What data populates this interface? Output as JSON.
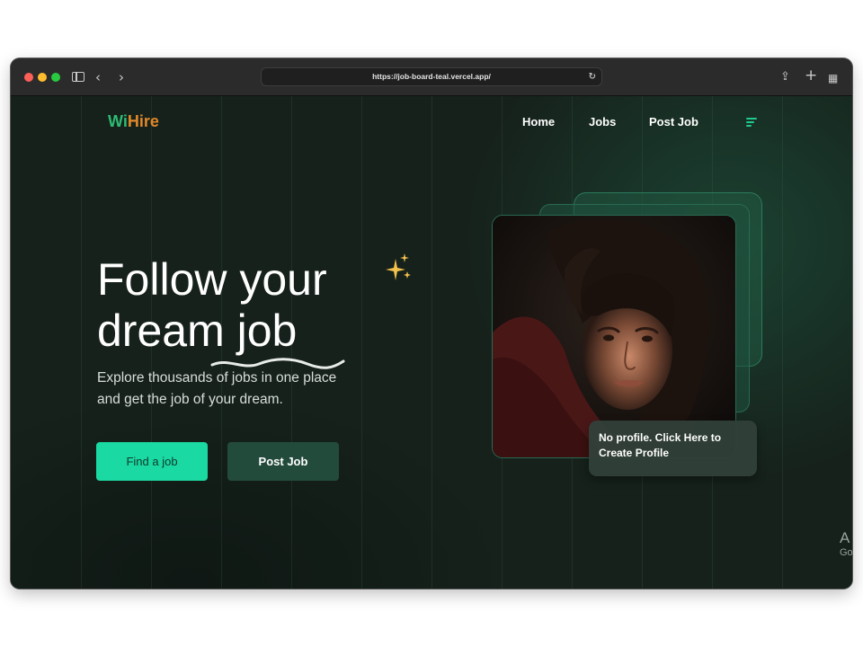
{
  "browser": {
    "url": "https://job-board-teal.vercel.app/",
    "icons": [
      "sidebar-icon",
      "back-icon",
      "forward-icon",
      "reload-icon",
      "share-icon",
      "new-tab-icon",
      "tab-overview-icon"
    ]
  },
  "header": {
    "logo_part1": "Wi",
    "logo_part2": "Hire",
    "nav": [
      {
        "label": "Home"
      },
      {
        "label": "Jobs"
      },
      {
        "label": "Post Job"
      }
    ]
  },
  "hero": {
    "title_line1": "Follow your",
    "title_line2": "dream job",
    "subtitle": "Explore thousands of jobs in one place and get the job of your dream.",
    "primary_button": "Find a job",
    "secondary_button": "Post Job"
  },
  "profile_card": {
    "text": "No profile. Click Here to Create Profile"
  },
  "watermark": {
    "line1": "A",
    "line2": "Go"
  },
  "colors": {
    "background": "#16211b",
    "accent": "#1bd9a2",
    "logo_green": "#2dbb73",
    "logo_orange": "#e0882a",
    "secondary_button": "#234b3c"
  }
}
